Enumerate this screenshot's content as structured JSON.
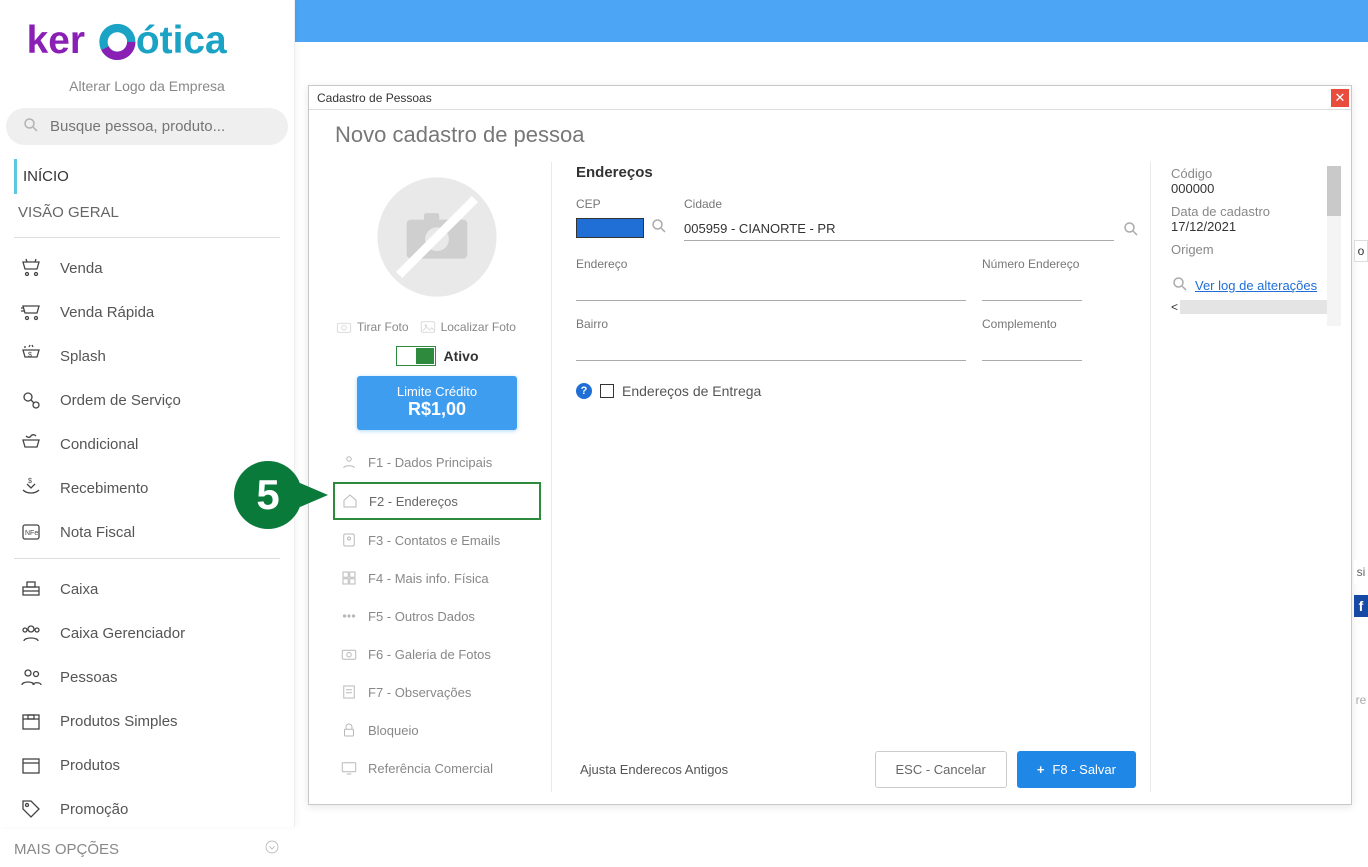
{
  "logo": {
    "subtitle": "Alterar Logo da Empresa"
  },
  "search": {
    "placeholder": "Busque pessoa, produto..."
  },
  "nav": {
    "inicio": "INÍCIO",
    "visao": "VISÃO GERAL",
    "items1": [
      {
        "label": "Venda"
      },
      {
        "label": "Venda Rápida"
      },
      {
        "label": "Splash"
      },
      {
        "label": "Ordem de Serviço"
      },
      {
        "label": "Condicional"
      },
      {
        "label": "Recebimento"
      },
      {
        "label": "Nota Fiscal"
      }
    ],
    "items2": [
      {
        "label": "Caixa"
      },
      {
        "label": "Caixa Gerenciador"
      },
      {
        "label": "Pessoas"
      },
      {
        "label": "Produtos Simples"
      },
      {
        "label": "Produtos"
      },
      {
        "label": "Promoção"
      }
    ],
    "more": "MAIS OPÇÕES"
  },
  "modal": {
    "header": "Cadastro de Pessoas",
    "title": "Novo cadastro de pessoa",
    "photo": {
      "tirar": "Tirar Foto",
      "localizar": "Localizar Foto"
    },
    "ativo": "Ativo",
    "credito": {
      "line1": "Limite Crédito",
      "line2": "R$1,00"
    },
    "tabs": [
      {
        "label": "F1 - Dados Principais"
      },
      {
        "label": "F2 - Endereços"
      },
      {
        "label": "F3 - Contatos e Emails"
      },
      {
        "label": "F4 - Mais info. Física"
      },
      {
        "label": "F5 - Outros Dados"
      },
      {
        "label": "F6 - Galeria de Fotos"
      },
      {
        "label": "F7 - Observações"
      },
      {
        "label": "Bloqueio"
      },
      {
        "label": "Referência Comercial"
      }
    ],
    "form": {
      "title": "Endereços",
      "cep": "CEP",
      "cidade": "Cidade",
      "cidade_val": "005959 - CIANORTE - PR",
      "endereco": "Endereço",
      "numero": "Número Endereço",
      "bairro": "Bairro",
      "complemento": "Complemento",
      "entrega": "Endereços de Entrega"
    },
    "footer": {
      "ajusta": "Ajusta Enderecos Antigos",
      "cancel": "ESC - Cancelar",
      "save": "F8 - Salvar"
    },
    "side": {
      "codigo_l": "Código",
      "codigo_v": "000000",
      "data_l": "Data de cadastro",
      "data_v": "17/12/2021",
      "origem_l": "Origem",
      "log": "Ver log de alterações"
    }
  },
  "step": "5"
}
